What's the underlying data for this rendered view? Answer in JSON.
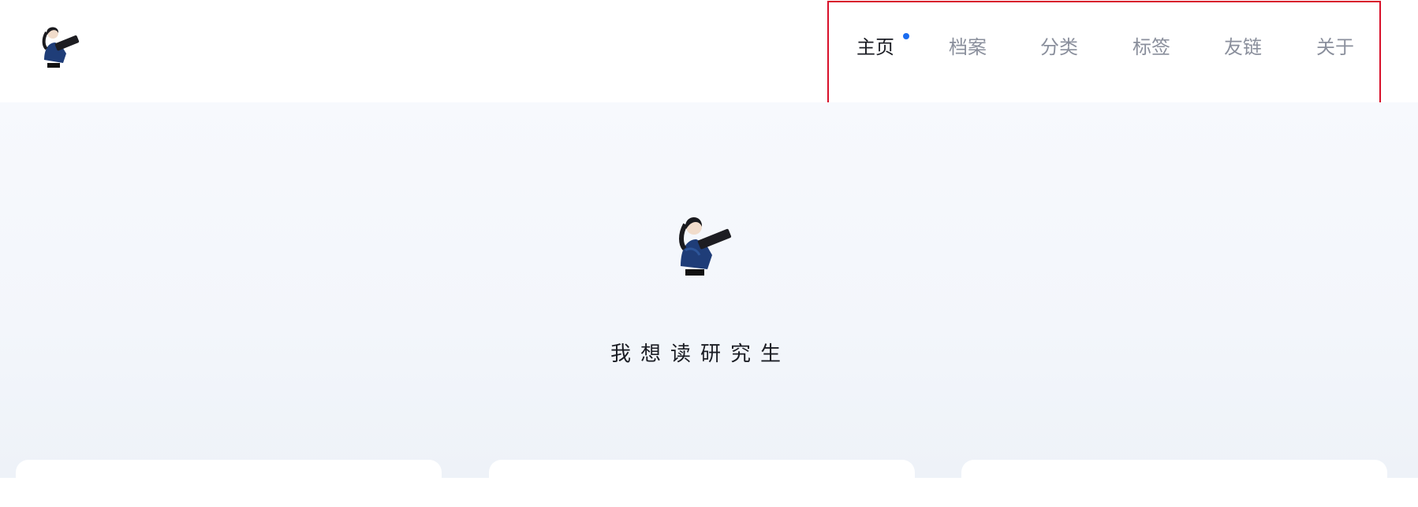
{
  "header": {
    "logo_icon": "character-logo-icon",
    "nav": [
      {
        "label": "主页",
        "active": true
      },
      {
        "label": "档案",
        "active": false
      },
      {
        "label": "分类",
        "active": false
      },
      {
        "label": "标签",
        "active": false
      },
      {
        "label": "友链",
        "active": false
      },
      {
        "label": "关于",
        "active": false
      }
    ]
  },
  "hero": {
    "avatar_icon": "character-avatar-icon",
    "title": "我想读研究生"
  },
  "colors": {
    "accent": "#1a6cf0",
    "highlight_border": "#d8102a",
    "text_active": "#1b1d24",
    "text_muted": "#8a8f9c"
  }
}
